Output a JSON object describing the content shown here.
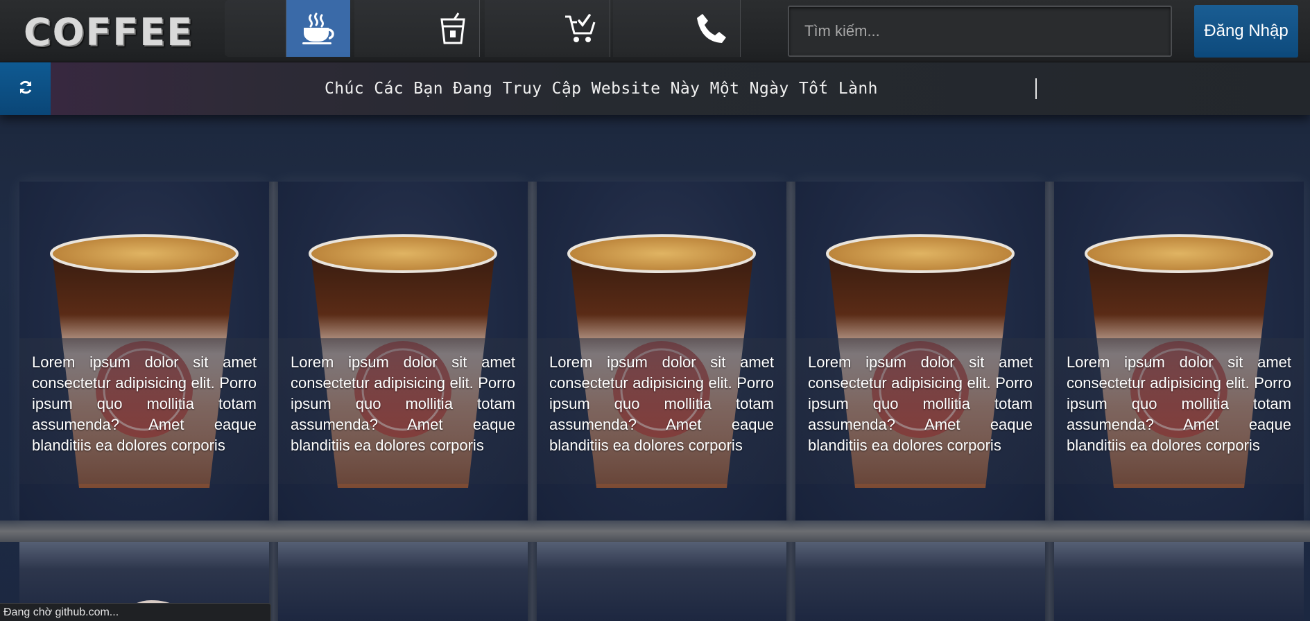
{
  "header": {
    "logo": "COFFEE",
    "nav": [
      {
        "name": "blank",
        "icon": ""
      },
      {
        "name": "coffee",
        "icon": "coffee-cup-icon",
        "active": true
      },
      {
        "name": "drinks",
        "icon": "drink-cup-icon"
      },
      {
        "name": "cart",
        "icon": "cart-check-icon"
      },
      {
        "name": "contact",
        "icon": "phone-icon"
      }
    ],
    "search_placeholder": "Tìm kiếm...",
    "login_label": "Đăng Nhập"
  },
  "ticker": {
    "refresh_icon": "refresh-icon",
    "message": "Chúc Các Bạn Đang Truy Cập Website Này Một Ngày Tốt Lành"
  },
  "cards": [
    {
      "text": "Lorem ipsum dolor sit amet consectetur adipisicing elit. Porro ipsum quo mollitia totam assumenda? Amet eaque blanditiis ea dolores corporis"
    },
    {
      "text": "Lorem ipsum dolor sit amet consectetur adipisicing elit. Porro ipsum quo mollitia totam assumenda? Amet eaque blanditiis ea dolores corporis"
    },
    {
      "text": "Lorem ipsum dolor sit amet consectetur adipisicing elit. Porro ipsum quo mollitia totam assumenda? Amet eaque blanditiis ea dolores corporis"
    },
    {
      "text": "Lorem ipsum dolor sit amet consectetur adipisicing elit. Porro ipsum quo mollitia totam assumenda? Amet eaque blanditiis ea dolores corporis"
    },
    {
      "text": "Lorem ipsum dolor sit amet consectetur adipisicing elit. Porro ipsum quo mollitia totam assumenda? Amet eaque blanditiis ea dolores corporis"
    }
  ],
  "status": "Đang chờ github.com...",
  "colors": {
    "accent_blue": "#3a6aa8",
    "button_blue": "#0d4a7c",
    "background": "#1f2c45"
  }
}
